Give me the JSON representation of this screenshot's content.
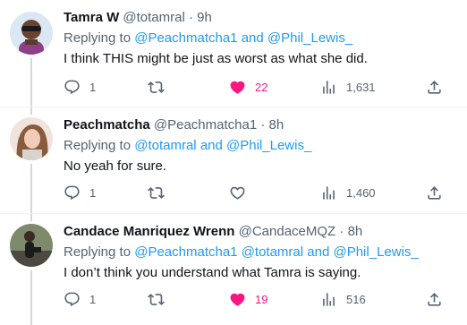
{
  "tweets": [
    {
      "name": "Tamra W",
      "handle": "@totamral",
      "dot": "·",
      "time": "9h",
      "replying_prefix": "Replying to",
      "mentions": [
        "@Peachmatcha1",
        "@Phil_Lewis_"
      ],
      "joiner": "and",
      "text": "I think THIS might be just as worst as what she did.",
      "replies": "1",
      "retweets": "",
      "likes": "22",
      "liked": true,
      "views": "1,631"
    },
    {
      "name": "Peachmatcha",
      "handle": "@Peachmatcha1",
      "dot": "·",
      "time": "8h",
      "replying_prefix": "Replying to",
      "mentions": [
        "@totamral",
        "@Phil_Lewis_"
      ],
      "joiner": "and",
      "text": "No yeah for sure.",
      "replies": "1",
      "retweets": "",
      "likes": "",
      "liked": false,
      "views": "1,460"
    },
    {
      "name": "Candace Manriquez Wrenn",
      "handle": "@CandaceMQZ",
      "dot": "·",
      "time": "8h",
      "replying_prefix": "Replying to",
      "mentions": [
        "@Peachmatcha1",
        "@totamral",
        "@Phil_Lewis_"
      ],
      "joiner": "and",
      "text": "I don’t think you understand what Tamra is saying.",
      "replies": "1",
      "retweets": "",
      "likes": "19",
      "liked": true,
      "views": "516"
    }
  ],
  "colors": {
    "accent": "#1d9bf0",
    "like": "#f91880",
    "secondary_text": "#536471",
    "divider": "#eff3f4"
  },
  "icons": {
    "reply": "reply-bubble-icon",
    "retweet": "retweet-arrows-icon",
    "like": "heart-icon",
    "views": "analytics-bars-icon",
    "share": "share-upload-icon"
  }
}
